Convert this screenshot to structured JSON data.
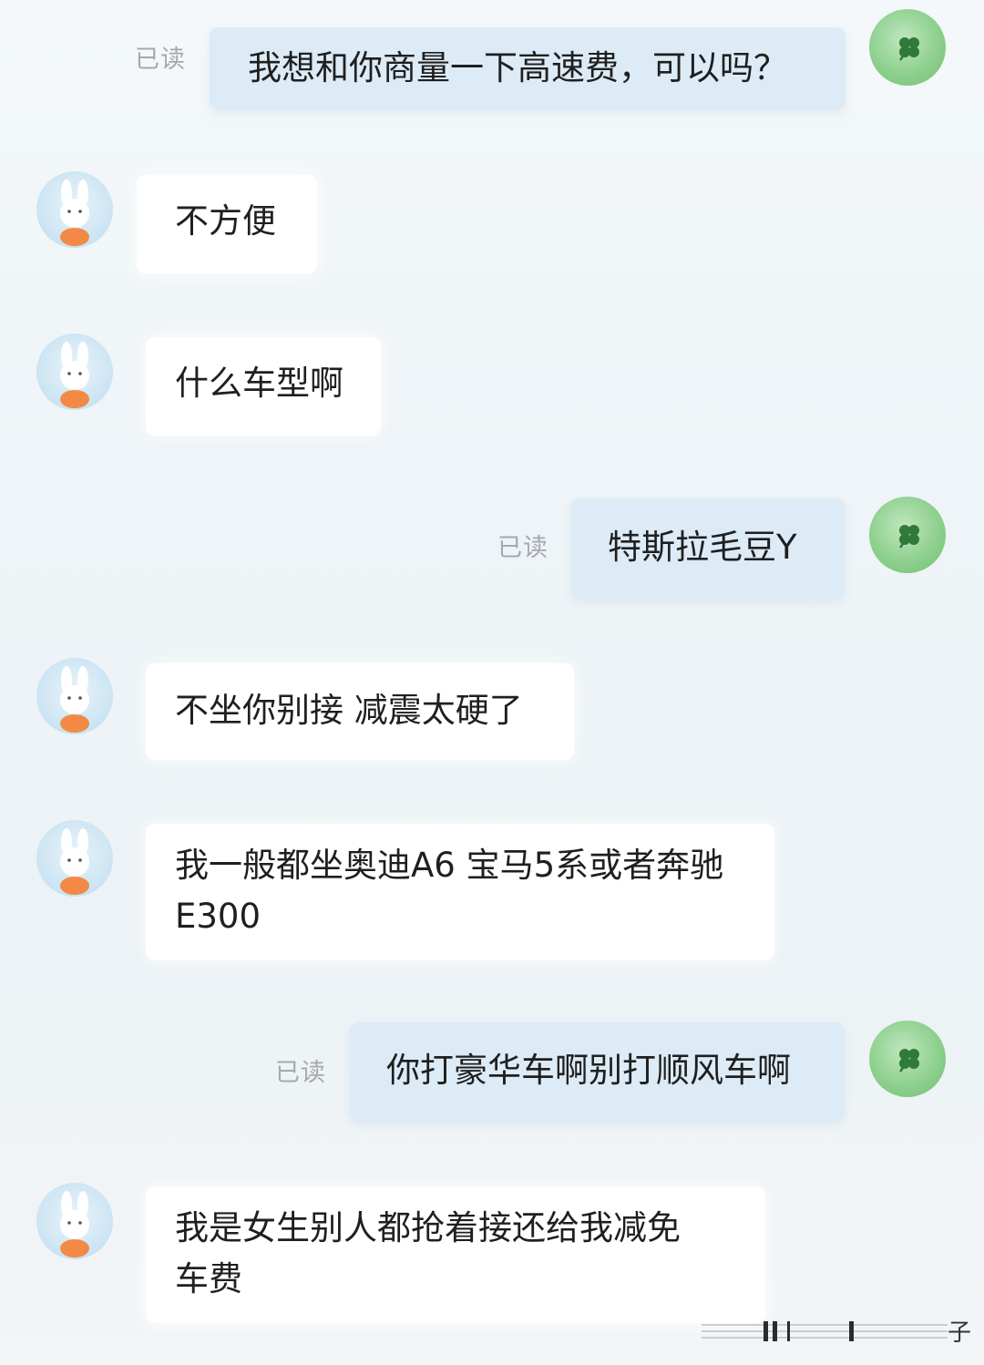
{
  "conversation": {
    "read_label": "已读",
    "messages": [
      {
        "id": "m1",
        "side": "out",
        "text": "我想和你商量一下高速费，可以吗？"
      },
      {
        "id": "m2",
        "side": "in",
        "text": "不方便"
      },
      {
        "id": "m3",
        "side": "in",
        "text": "什么车型啊"
      },
      {
        "id": "m4",
        "side": "out",
        "text": "特斯拉毛豆Y"
      },
      {
        "id": "m5",
        "side": "in",
        "text": "不坐你别接 减震太硬了"
      },
      {
        "id": "m6",
        "side": "in",
        "lines": [
          "我一般都坐奥迪A6 宝马5系或者奔驰",
          "E300"
        ]
      },
      {
        "id": "m7",
        "side": "out",
        "text": "你打豪华车啊别打顺风车啊"
      },
      {
        "id": "m8",
        "side": "in",
        "lines": [
          "我是女生别人都抢着接还给我减免",
          "车费"
        ]
      }
    ]
  },
  "watermark": {
    "text": "子"
  },
  "colors": {
    "bubble_out": "#dcebf6",
    "bubble_in": "#ffffff",
    "read_label": "#a5a9ad",
    "clover_avatar": "#8fd08f",
    "bunny_avatar": "#cfe6f4"
  },
  "icons": {
    "incoming_avatar": "bunny-avatar-icon",
    "outgoing_avatar": "clover-avatar-icon"
  }
}
